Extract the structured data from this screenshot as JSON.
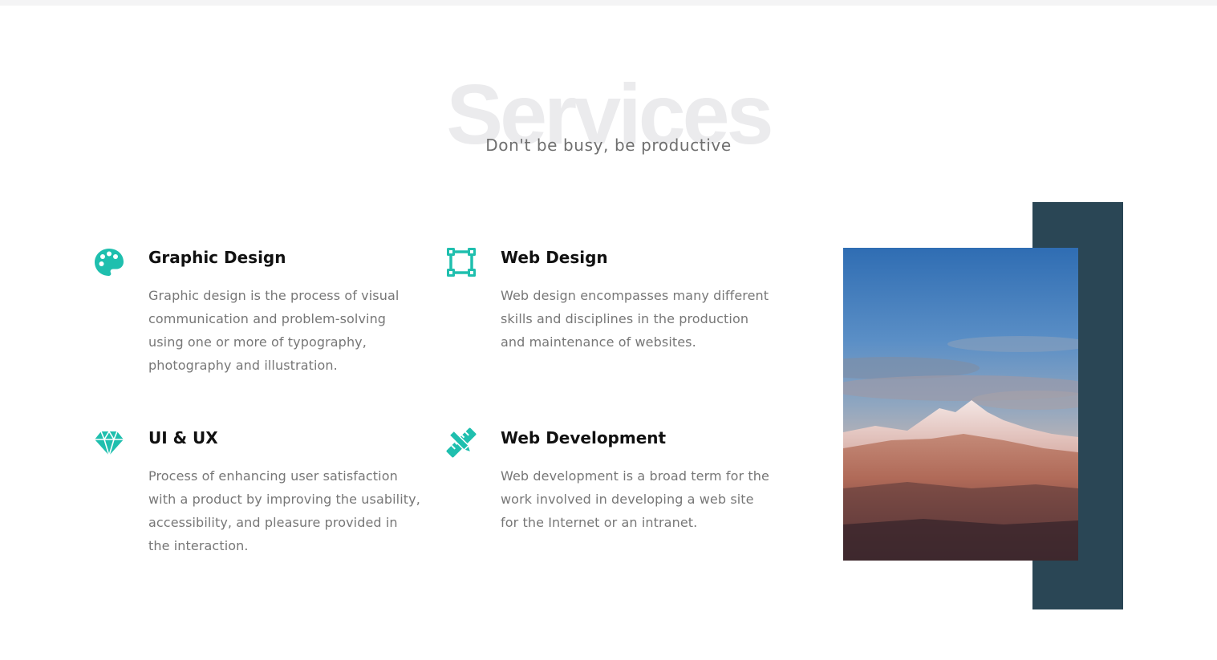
{
  "section": {
    "title": "Services",
    "subtitle": "Don't be busy, be productive"
  },
  "services": [
    {
      "title": "Graphic Design",
      "icon": "palette-icon",
      "description": "Graphic design is the process of visual communication and problem-solving using one or more of typography, photography and illustration."
    },
    {
      "title": "Web Design",
      "icon": "vector-square-icon",
      "description": "Web design encompasses many different skills and disciplines in the production and maintenance of websites."
    },
    {
      "title": "UI & UX",
      "icon": "gem-icon",
      "description": "Process of enhancing user satisfaction with a product by improving the usability, accessibility, and pleasure provided in the interaction."
    },
    {
      "title": "Web Development",
      "icon": "pencil-ruler-icon",
      "description": "Web development is a broad term for the work involved in developing a web site for the Internet or an intranet."
    }
  ],
  "colors": {
    "accent": "#1fbfae",
    "dark_block": "#2a4655",
    "heading_bg": "#ebebed"
  },
  "image": {
    "subject": "mountain-landscape-photo"
  }
}
